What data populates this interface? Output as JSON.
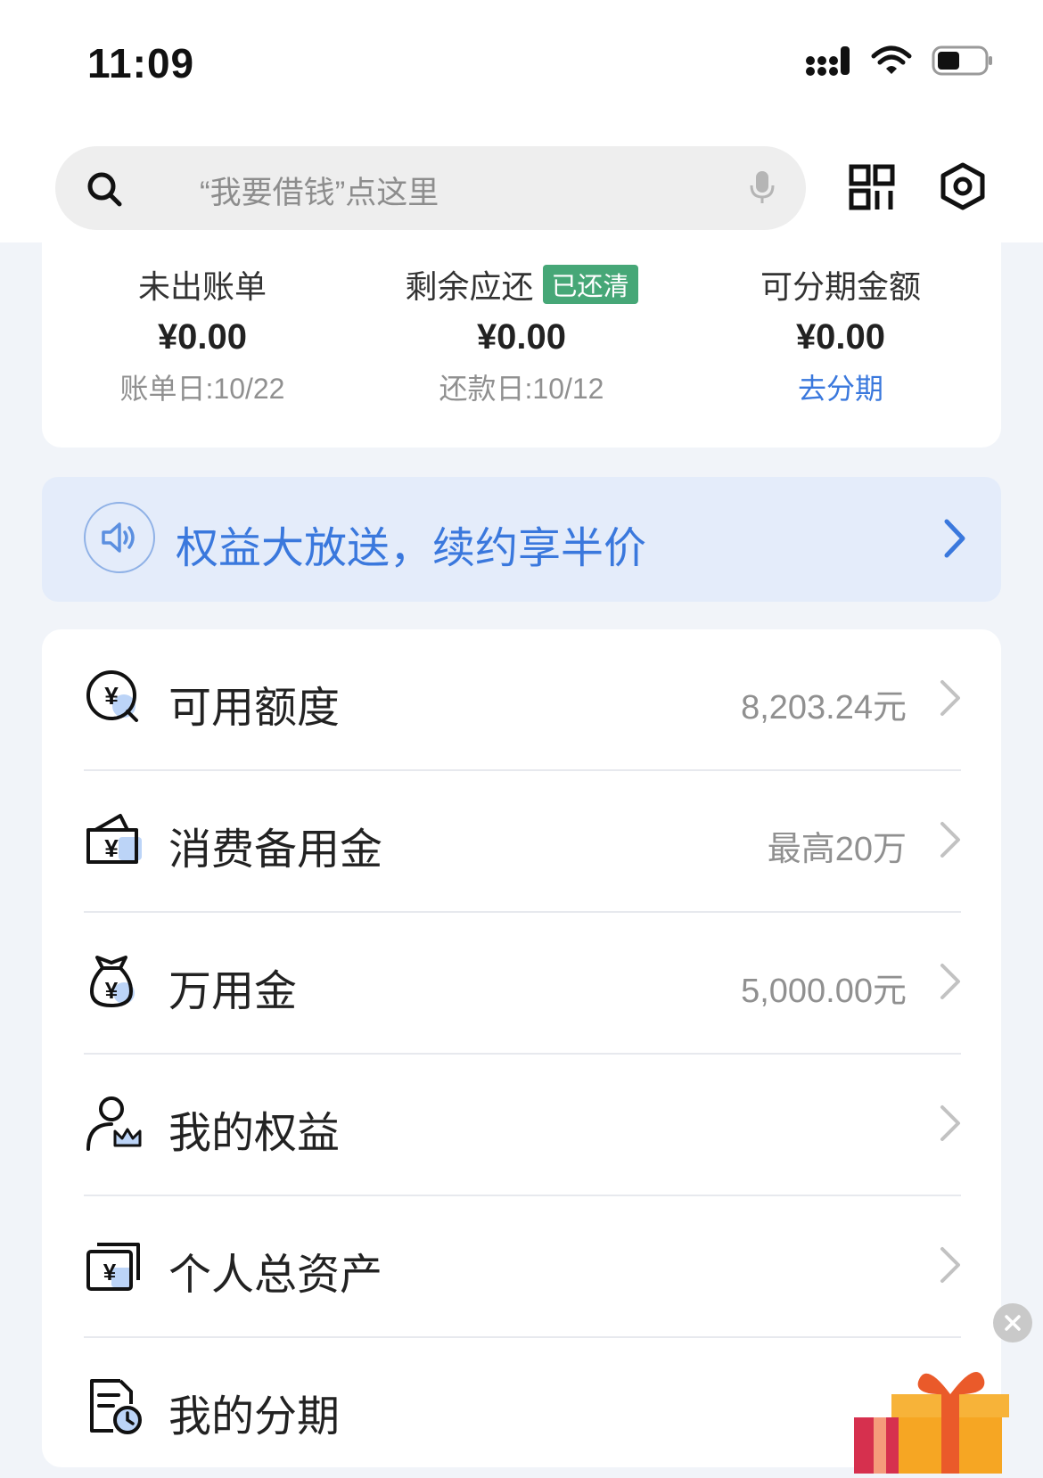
{
  "status_bar": {
    "time": "11:09"
  },
  "header": {
    "search_placeholder": "“我要借钱”点这里"
  },
  "summary": {
    "unbilled": {
      "label": "未出账单",
      "value": "¥0.00",
      "sub": "账单日:10/22"
    },
    "remaining": {
      "label": "剩余应还",
      "badge": "已还清",
      "value": "¥0.00",
      "sub": "还款日:10/12"
    },
    "installment": {
      "label": "可分期金额",
      "value": "¥0.00",
      "link": "去分期"
    }
  },
  "banner": {
    "text": "权益大放送，续约享半价"
  },
  "menu": {
    "items": [
      {
        "label": "可用额度",
        "value": "8,203.24元",
        "icon": "yuan-search-icon"
      },
      {
        "label": "消费备用金",
        "value": "最高20万",
        "icon": "yuan-wallet-icon"
      },
      {
        "label": "万用金",
        "value": "5,000.00元",
        "icon": "money-bag-icon"
      },
      {
        "label": "我的权益",
        "value": "",
        "icon": "user-crown-icon"
      },
      {
        "label": "个人总资产",
        "value": "",
        "icon": "yuan-cards-icon"
      },
      {
        "label": "我的分期",
        "value": "",
        "icon": "bill-clock-icon"
      }
    ]
  },
  "colors": {
    "accent": "#3a78dd",
    "badge_green": "#46a777",
    "page_bg": "#f1f4f9",
    "banner_bg": "#e4ecfa"
  }
}
